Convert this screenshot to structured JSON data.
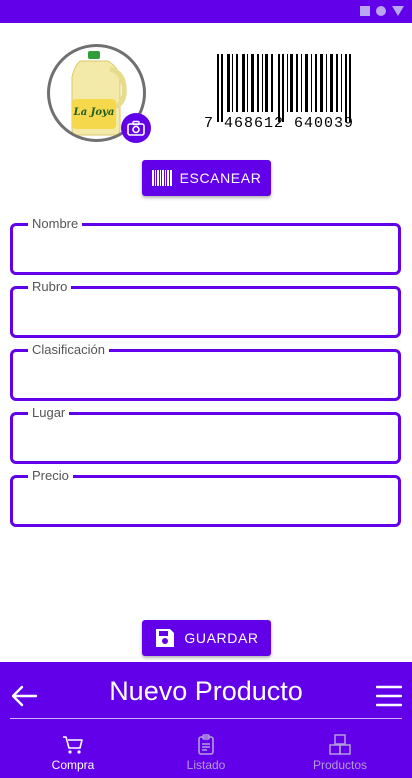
{
  "barcode_number": "7 468612 640039",
  "buttons": {
    "scan": "ESCANEAR",
    "save": "GUARDAR"
  },
  "form": {
    "fields": [
      {
        "label": "Nombre",
        "value": ""
      },
      {
        "label": "Rubro",
        "value": ""
      },
      {
        "label": "Clasificación",
        "value": ""
      },
      {
        "label": "Lugar",
        "value": ""
      },
      {
        "label": "Precio",
        "value": ""
      }
    ]
  },
  "header": {
    "title": "Nuevo Producto"
  },
  "tabs": [
    {
      "label": "Compra",
      "active": true
    },
    {
      "label": "Listado",
      "active": false
    },
    {
      "label": "Productos",
      "active": false
    }
  ],
  "product_image": {
    "brand_text": "La Joya"
  },
  "colors": {
    "accent": "#6200ea",
    "inactive_tab": "#b39ddb"
  }
}
